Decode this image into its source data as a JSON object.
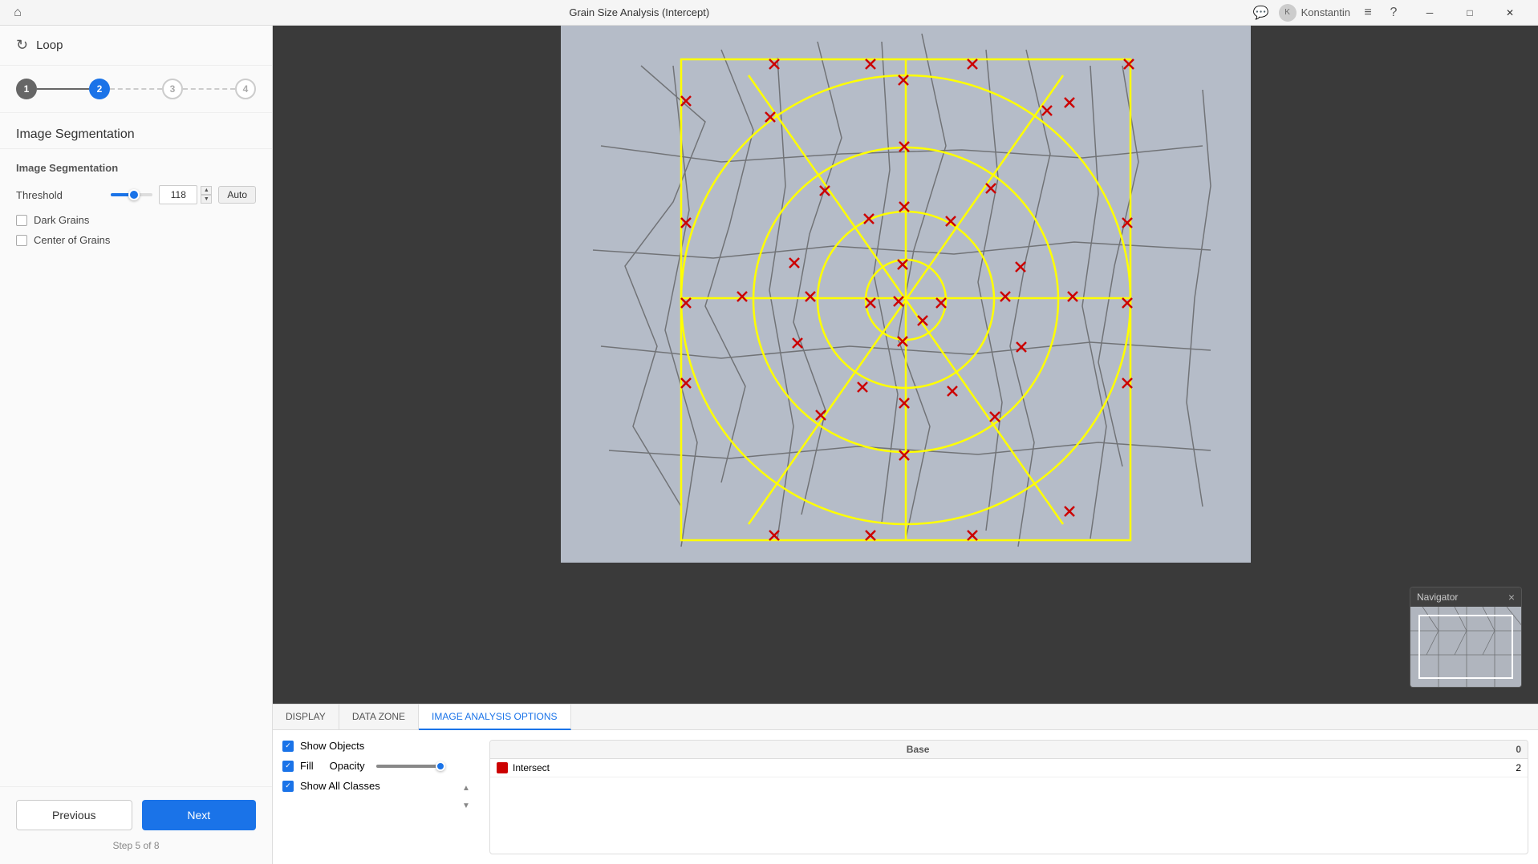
{
  "titlebar": {
    "title": "Grain Size Analysis (Intercept)",
    "user": "Konstantin",
    "icons": {
      "chat": "💬",
      "menu": "≡",
      "help": "?"
    }
  },
  "left_panel": {
    "loop_label": "Loop",
    "steps": [
      {
        "number": "1",
        "state": "done"
      },
      {
        "number": "2",
        "state": "active"
      },
      {
        "number": "3",
        "state": "pending"
      },
      {
        "number": "4",
        "state": "pending"
      }
    ],
    "section_title": "Image Segmentation",
    "subsection_title": "Image Segmentation",
    "threshold_label": "Threshold",
    "threshold_value": "118",
    "auto_label": "Auto",
    "dark_grains_label": "Dark Grains",
    "center_of_grains_label": "Center of Grains"
  },
  "navigation": {
    "previous_label": "Previous",
    "next_label": "Next",
    "step_info": "Step 5 of 8"
  },
  "tabs": {
    "items": [
      {
        "id": "display",
        "label": "DISPLAY"
      },
      {
        "id": "data_zone",
        "label": "DATA ZONE"
      },
      {
        "id": "image_analysis",
        "label": "IMAGE ANALYSIS OPTIONS"
      }
    ],
    "active": "image_analysis"
  },
  "display_options": {
    "show_objects_label": "Show Objects",
    "show_all_classes_label": "Show All Classes",
    "fill_label": "Fill",
    "opacity_label": "Opacity"
  },
  "class_table": {
    "columns": [
      "",
      "Base",
      "0"
    ],
    "rows": [
      {
        "color": "#cc0000",
        "name": "Intersect",
        "value": "2"
      }
    ]
  },
  "navigator": {
    "title": "Navigator",
    "close": "×"
  },
  "slider": {
    "threshold_percent": 55
  }
}
